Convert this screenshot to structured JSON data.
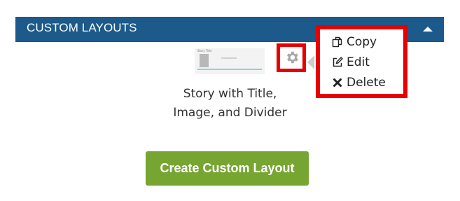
{
  "panel": {
    "title": "CUSTOM LAYOUTS",
    "header_color": "#1b5a8a",
    "collapse_icon": "caret-up-icon"
  },
  "layout_card": {
    "thumbnail_title": "Story Title",
    "name_line1": "Story with Title,",
    "name_line2": "Image, and Divider",
    "settings_icon": "gear-icon"
  },
  "context_menu": {
    "items": [
      {
        "label": "Copy",
        "icon": "copy-icon"
      },
      {
        "label": "Edit",
        "icon": "edit-icon"
      },
      {
        "label": "Delete",
        "icon": "delete-icon"
      }
    ],
    "highlight_color": "#e60000"
  },
  "create_button": {
    "label": "Create Custom Layout",
    "color": "#76a531"
  }
}
